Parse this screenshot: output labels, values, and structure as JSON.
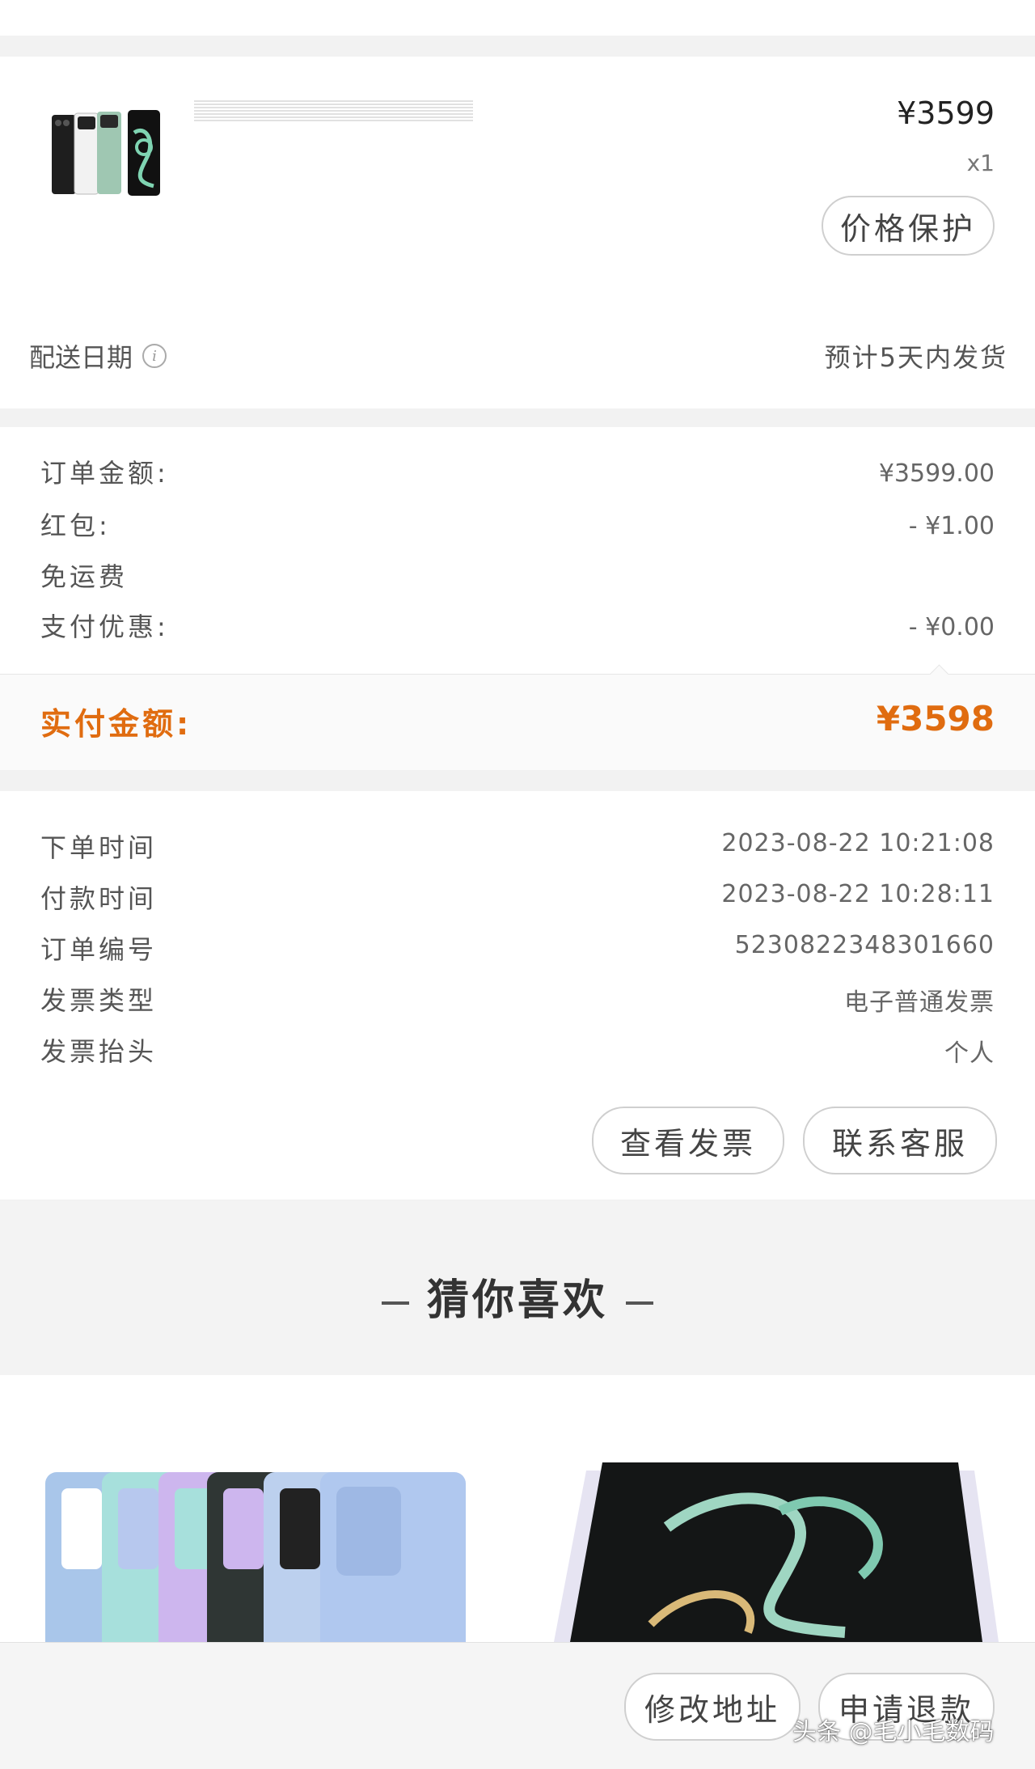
{
  "product": {
    "price": "¥3599",
    "quantity": "x1",
    "price_protect_label": "价格保护",
    "delivery_label": "配送日期",
    "delivery_value": "预计5天内发货"
  },
  "amounts": {
    "order_amount_label": "订单金额:",
    "order_amount_value": "¥3599.00",
    "red_packet_label": "红包:",
    "red_packet_value": "- ¥1.00",
    "free_shipping_label": "免运费",
    "pay_discount_label": "支付优惠:",
    "pay_discount_value": "- ¥0.00",
    "paid_label": "实付金额:",
    "paid_value": "¥3598"
  },
  "order_info": {
    "rows": [
      {
        "label": "下单时间",
        "value": "2023-08-22 10:21:08"
      },
      {
        "label": "付款时间",
        "value": "2023-08-22 10:28:11"
      },
      {
        "label": "订单编号",
        "value": "5230822348301660"
      },
      {
        "label": "发票类型",
        "value": "电子普通发票"
      },
      {
        "label": "发票抬头",
        "value": "个人"
      }
    ],
    "view_invoice_label": "查看发票",
    "contact_service_label": "联系客服"
  },
  "recommend": {
    "title": "猜你喜欢"
  },
  "bottom_bar": {
    "modify_address_label": "修改地址",
    "refund_label": "申请退款"
  },
  "watermark": "头条 @毛小毛数码",
  "colors": {
    "accent": "#e06c10",
    "background": "#f2f2f2",
    "card": "#ffffff"
  }
}
